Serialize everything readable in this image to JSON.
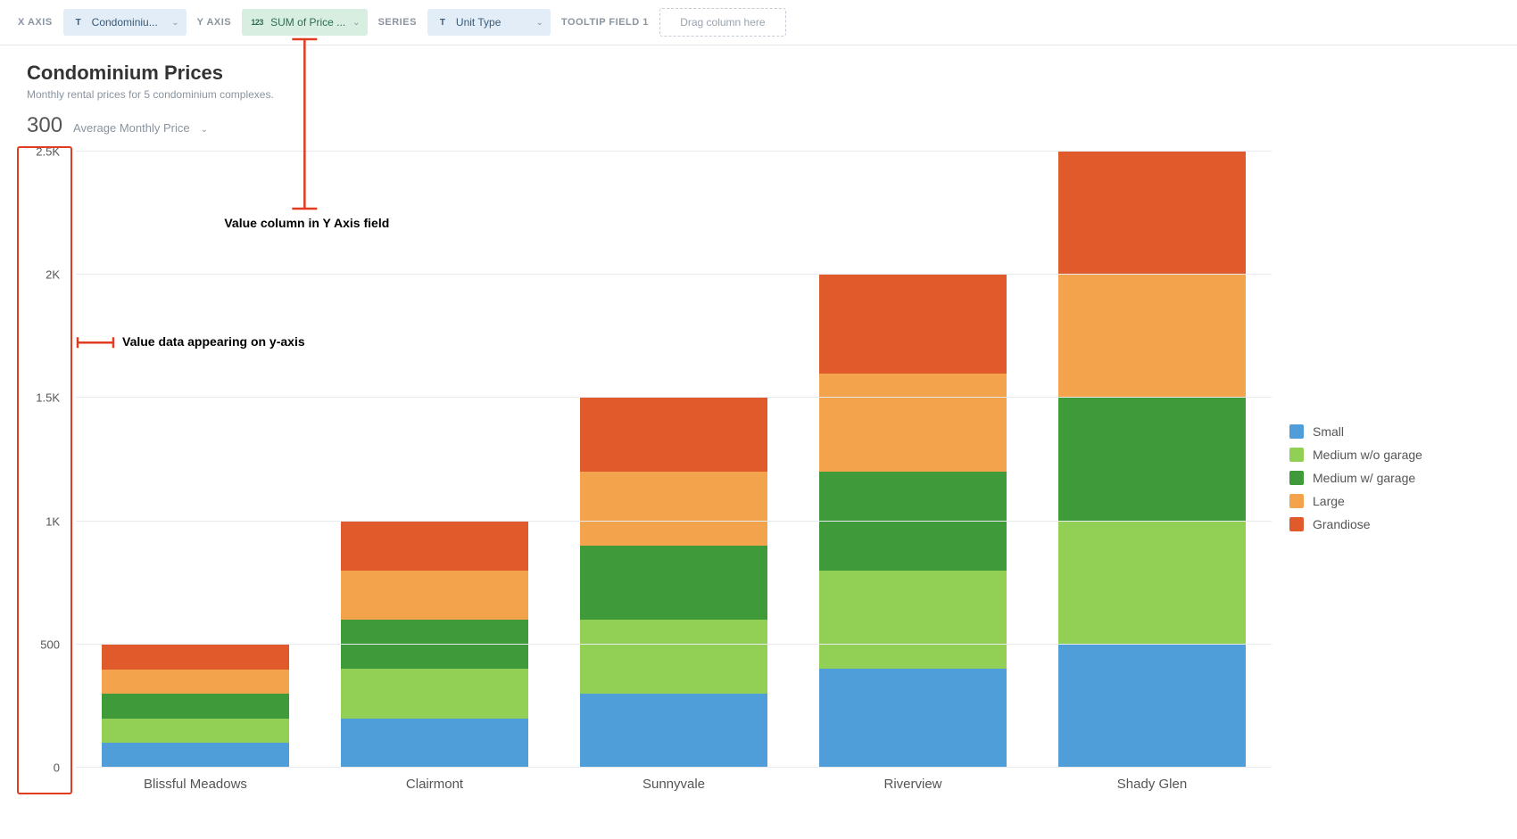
{
  "config": {
    "xaxis": {
      "label": "X AXIS",
      "icon": "T",
      "value": "Condominiu..."
    },
    "yaxis": {
      "label": "Y AXIS",
      "icon": "123",
      "value": "SUM of Price ..."
    },
    "series": {
      "label": "SERIES",
      "icon": "T",
      "value": "Unit Type"
    },
    "tooltip": {
      "label": "TOOLTIP FIELD 1",
      "placeholder": "Drag column here"
    }
  },
  "header": {
    "title": "Condominium Prices",
    "subtitle": "Monthly rental prices for 5 condominium complexes.",
    "metric_value": "300",
    "metric_label": "Average Monthly Price"
  },
  "chart_data": {
    "type": "bar",
    "stacked": true,
    "ylabel": "",
    "xlabel": "",
    "ylim": [
      0,
      2500
    ],
    "y_ticks": [
      0,
      500,
      1000,
      1500,
      2000,
      2500
    ],
    "y_tick_labels": [
      "0",
      "500",
      "1K",
      "1.5K",
      "2K",
      "2.5K"
    ],
    "categories": [
      "Blissful Meadows",
      "Clairmont",
      "Sunnyvale",
      "Riverview",
      "Shady Glen"
    ],
    "series": [
      {
        "name": "Small",
        "color": "#4f9ed9",
        "values": [
          100,
          200,
          300,
          400,
          500
        ]
      },
      {
        "name": "Medium w/o garage",
        "color": "#92cf55",
        "values": [
          100,
          200,
          300,
          400,
          500
        ]
      },
      {
        "name": "Medium w/ garage",
        "color": "#3f9b3a",
        "values": [
          100,
          200,
          300,
          400,
          500
        ]
      },
      {
        "name": "Large",
        "color": "#f2a34b",
        "values": [
          100,
          200,
          300,
          400,
          500
        ]
      },
      {
        "name": "Grandiose",
        "color": "#e05a2b",
        "values": [
          100,
          200,
          300,
          400,
          500
        ]
      }
    ]
  },
  "annotations": {
    "yfield": "Value column in Y Axis field",
    "yaxis_data": "Value data appearing on y-axis"
  }
}
